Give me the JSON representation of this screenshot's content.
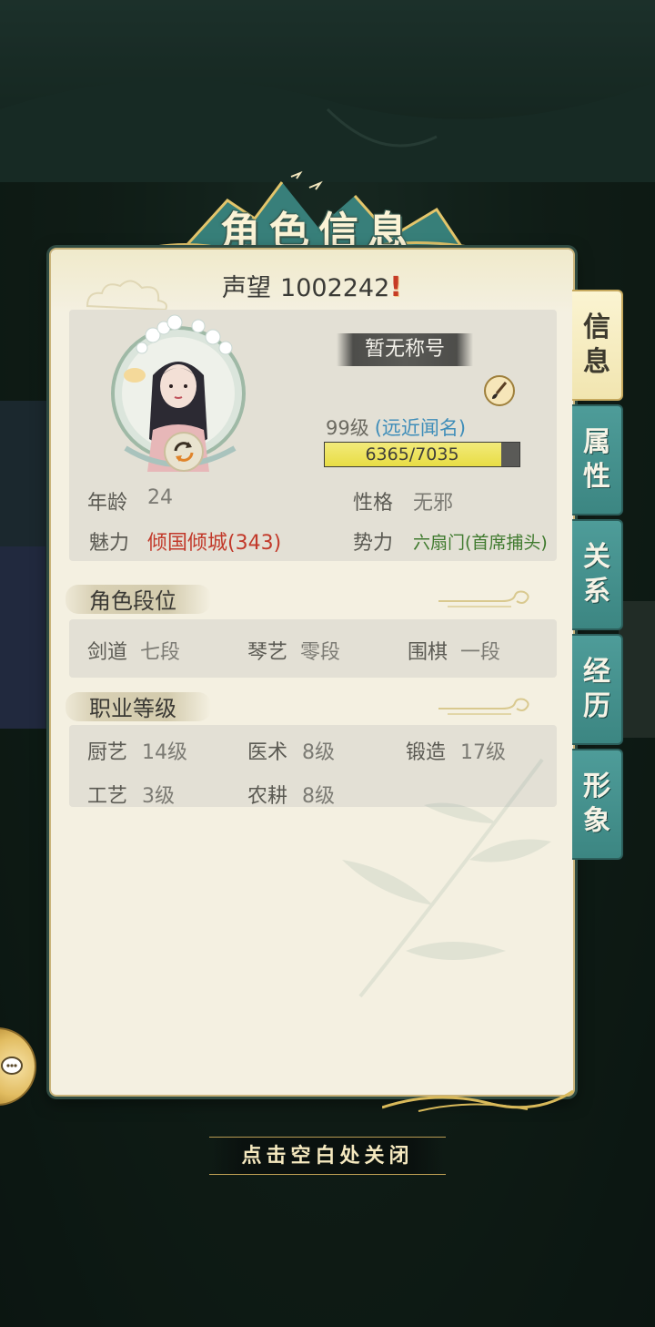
{
  "dialog": {
    "title": "角色信息",
    "reputation_label": "声望",
    "reputation_value": "1002242",
    "close_hint": "点击空白处关闭"
  },
  "profile": {
    "title_plate": "暂无称号",
    "level": "99级",
    "fame": "(远近闻名)",
    "exp_text": "6365/7035",
    "exp_current": 6365,
    "exp_max": 7035,
    "age_label": "年龄",
    "age_value": "24",
    "personality_label": "性格",
    "personality_value": "无邪",
    "charm_label": "魅力",
    "charm_value": "倾国倾城(343)",
    "faction_label": "势力",
    "faction_value": "六扇门(首席捕头)"
  },
  "rank_section": {
    "title": "角色段位",
    "items": [
      {
        "label": "剑道",
        "value": "七段"
      },
      {
        "label": "琴艺",
        "value": "零段"
      },
      {
        "label": "围棋",
        "value": "一段"
      }
    ]
  },
  "job_section": {
    "title": "职业等级",
    "items": [
      {
        "label": "厨艺",
        "value": "14级"
      },
      {
        "label": "医术",
        "value": "8级"
      },
      {
        "label": "锻造",
        "value": "17级"
      },
      {
        "label": "工艺",
        "value": "3级"
      },
      {
        "label": "农耕",
        "value": "8级"
      }
    ]
  },
  "tabs": [
    {
      "chars": [
        "信",
        "息"
      ],
      "active": true
    },
    {
      "chars": [
        "属",
        "性"
      ],
      "active": false
    },
    {
      "chars": [
        "关",
        "系"
      ],
      "active": false
    },
    {
      "chars": [
        "经",
        "历"
      ],
      "active": false
    },
    {
      "chars": [
        "形",
        "象"
      ],
      "active": false
    }
  ],
  "colors": {
    "panel_bg": "#f4f0e1",
    "tab_teal": "#4e9c99",
    "tab_active": "#fbf4d2",
    "charm_red": "#c2392a",
    "faction_green": "#3f7a2e",
    "fame_blue": "#3e8db9",
    "exp_fill": "#e8dd45"
  },
  "icons": {
    "alert": "exclamation-icon",
    "brush": "brush-icon",
    "swap": "swap-icon",
    "chat": "chat-icon"
  }
}
